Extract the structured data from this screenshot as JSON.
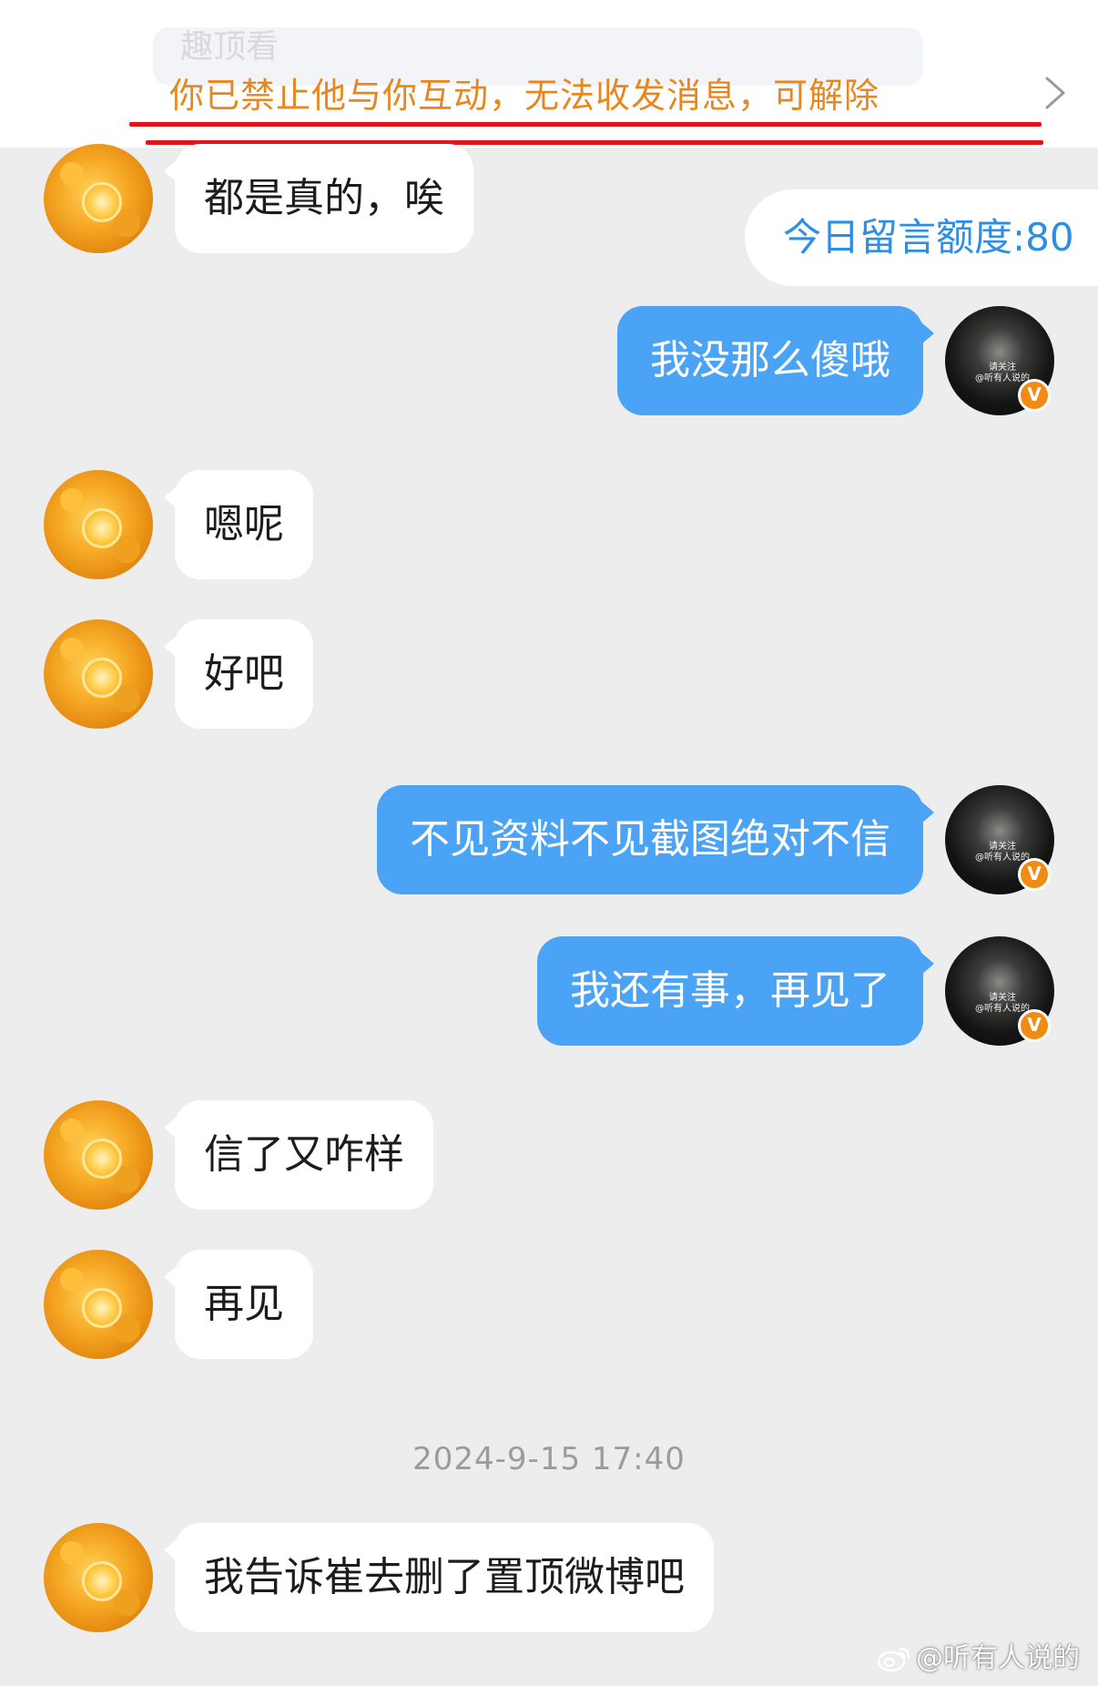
{
  "banner": {
    "ghost_text": "趣顶看",
    "notice": "你已禁止他与你互动，无法收发消息，可解除",
    "chevron_icon": "chevron-right-icon",
    "notice_color": "#e8871e",
    "underline_color": "#e0141b"
  },
  "quota": {
    "text": "今日留言额度:80"
  },
  "messages": [
    {
      "side": "in",
      "text": "都是真的，唉"
    },
    {
      "side": "out",
      "text": "我没那么傻哦"
    },
    {
      "side": "in",
      "text": "嗯呢"
    },
    {
      "side": "in",
      "text": "好吧"
    },
    {
      "side": "out",
      "text": "不见资料不见截图绝对不信"
    },
    {
      "side": "out",
      "text": "我还有事，再见了"
    },
    {
      "side": "in",
      "text": "信了又咋样"
    },
    {
      "side": "in",
      "text": "再见"
    },
    {
      "side": "in",
      "text": "我告诉崔去删了置顶微博吧"
    }
  ],
  "timestamp": "2024-9-15 17:40",
  "self_avatar": {
    "caption_line1": "请关注",
    "caption_line2": "@听有人说的",
    "verified_badge": "V"
  },
  "watermark": {
    "text": "@听有人说的",
    "icon": "weibo-logo-icon"
  },
  "colors": {
    "outgoing_bubble": "#4ba3f5",
    "incoming_bubble": "#ffffff",
    "background": "#ededed",
    "quota_text": "#2d8ee6",
    "verified_badge": "#f28b14"
  }
}
